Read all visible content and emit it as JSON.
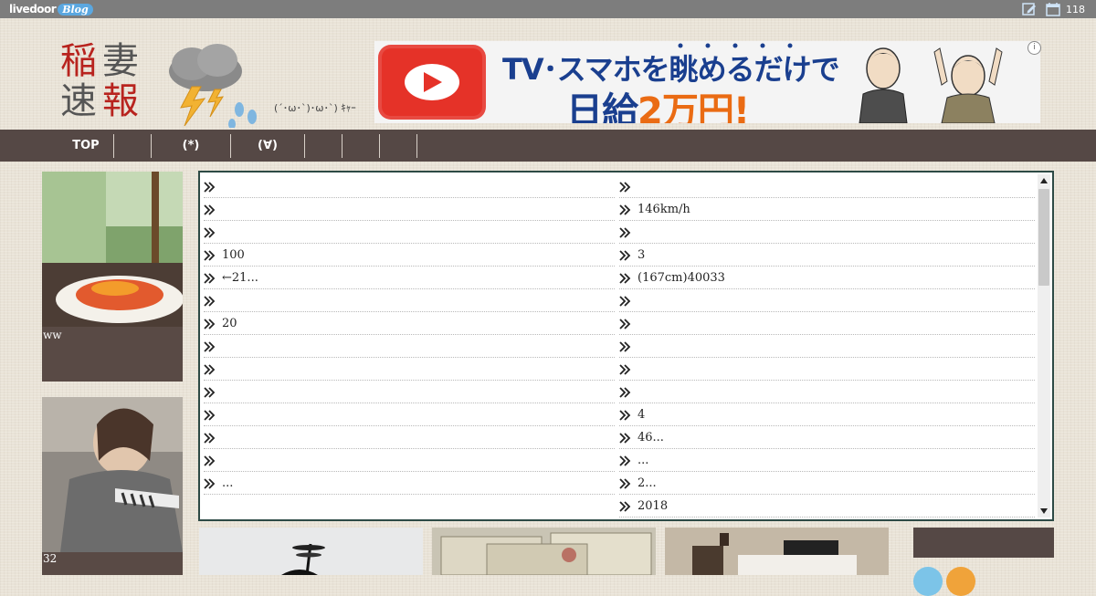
{
  "topbar": {
    "brand_main": "livedoor",
    "brand_sub": "Blog",
    "count": "118",
    "icons": [
      "edit-icon",
      "calendar-icon"
    ]
  },
  "header": {
    "logo_chars": [
      "稲",
      "妻",
      "速",
      "報"
    ],
    "kaomoji": "(´･ω･`)･ω･`) ｷｬｰ"
  },
  "ad": {
    "headline": "TV･スマホを眺めるだけで",
    "sub_prefix": "日給",
    "sub_highlight": "2万円!",
    "info": "i"
  },
  "nav": {
    "items": [
      "TOP",
      "",
      "(*)",
      "(∀)",
      "",
      "",
      ""
    ]
  },
  "sidebar": {
    "cards": [
      {
        "caption": "ww"
      },
      {
        "caption": "32"
      }
    ]
  },
  "panel": {
    "left": [
      "",
      "",
      "",
      "100",
      "←21...",
      "",
      "20",
      "",
      "",
      "",
      "",
      "",
      "",
      "..."
    ],
    "right": [
      "",
      "146km/h",
      "",
      "3",
      "(167cm)40033",
      "",
      "",
      "",
      "",
      "",
      "4",
      "46...",
      "...",
      "2...",
      "2018"
    ]
  },
  "colors": {
    "topbar": "#7d7d7d",
    "nav": "#554845",
    "panel_border": "#2d4a45",
    "logo_red": "#b8231e",
    "logo_gray": "#555555",
    "ad_blue": "#1a3f8f",
    "ad_orange": "#ea6b13"
  }
}
